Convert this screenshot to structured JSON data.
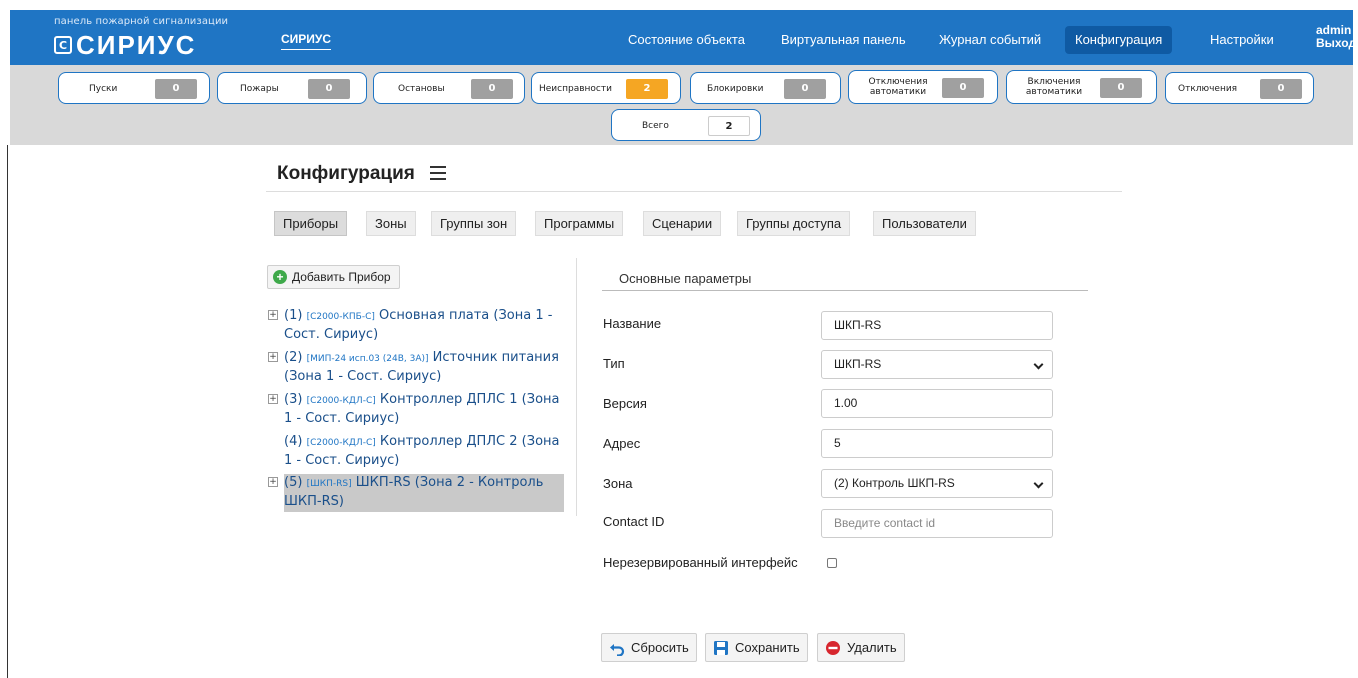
{
  "brand": {
    "subtitle": "панель пожарной сигнализации",
    "logo_mark": "С",
    "logo_word": "СИРИУС",
    "site_name": "СИРИУС"
  },
  "nav": {
    "items": [
      {
        "label": "Состояние объекта"
      },
      {
        "label": "Виртуальная панель"
      },
      {
        "label": "Журнал событий"
      },
      {
        "label": "Конфигурация"
      },
      {
        "label": "Настройки"
      }
    ],
    "user": "admin",
    "logout": "Выход"
  },
  "counters": [
    {
      "label": "Пуски",
      "value": "0"
    },
    {
      "label": "Пожары",
      "value": "0"
    },
    {
      "label": "Остановы",
      "value": "0"
    },
    {
      "label": "Неисправности",
      "value": "2"
    },
    {
      "label": "Блокировки",
      "value": "0"
    },
    {
      "label": "Отключения автоматики",
      "value": "0"
    },
    {
      "label": "Включения автоматики",
      "value": "0"
    },
    {
      "label": "Отключения",
      "value": "0"
    },
    {
      "label": "Всего",
      "value": "2"
    }
  ],
  "colors": {
    "accent": "#1f75c4",
    "warning": "#f5a623",
    "counter_zero": "#a0a0a0"
  },
  "page": {
    "title": "Конфигурация",
    "menu_icon": "hamburger-icon"
  },
  "tabs": [
    {
      "label": "Приборы"
    },
    {
      "label": "Зоны"
    },
    {
      "label": "Группы зон"
    },
    {
      "label": "Программы"
    },
    {
      "label": "Сценарии"
    },
    {
      "label": "Группы доступа"
    },
    {
      "label": "Пользователи"
    }
  ],
  "devices": {
    "add_label": "Добавить Прибор",
    "items": [
      {
        "num": "(1)",
        "model": "[С2000-КПБ-С]",
        "name": "Основная плата (Зона 1 - Сост. Сириус)",
        "expander": "+"
      },
      {
        "num": "(2)",
        "model": "[МИП-24 исп.03 (24В, 3А)]",
        "name": "Источник питания (Зона 1 - Сост. Сириус)",
        "expander": "+"
      },
      {
        "num": "(3)",
        "model": "[С2000-КДЛ-С]",
        "name": "Контроллер ДПЛС 1 (Зона 1 - Сост. Сириус)",
        "expander": "+"
      },
      {
        "num": "(4)",
        "model": "[С2000-КДЛ-С]",
        "name": "Контроллер ДПЛС 2 (Зона 1 - Сост. Сириус)",
        "expander": ""
      },
      {
        "num": "(5)",
        "model": "[ШКП-RS]",
        "name": "ШКП-RS (Зона 2 - Контроль ШКП-RS)",
        "expander": "+"
      }
    ]
  },
  "form": {
    "section_title": "Основные параметры",
    "name_label": "Название",
    "name_value": "ШКП-RS",
    "type_label": "Тип",
    "type_value": "ШКП-RS",
    "version_label": "Версия",
    "version_value": "1.00",
    "address_label": "Адрес",
    "address_value": "5",
    "zone_label": "Зона",
    "zone_value": "(2) Контроль ШКП-RS",
    "contact_label": "Contact ID",
    "contact_placeholder": "Введите contact id",
    "nonredundant_label": "Нерезервированный интерфейс"
  },
  "actions": {
    "reset": "Сбросить",
    "save": "Сохранить",
    "delete": "Удалить"
  }
}
